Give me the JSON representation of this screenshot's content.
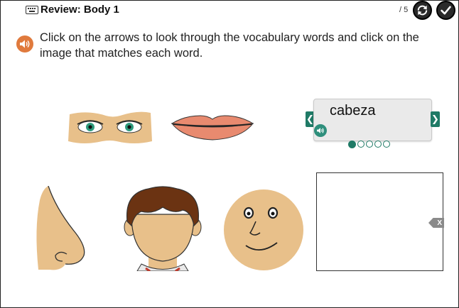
{
  "header": {
    "title": "Review: Body 1",
    "page_count": "/ 5",
    "keyboard_icon": "keyboard-icon",
    "refresh_icon": "refresh-icon",
    "check_icon": "check-icon"
  },
  "instructions": {
    "text": "Click on the arrows to look through the vocabulary words and click on the image that matches each word.",
    "audio_icon": "speaker-icon"
  },
  "vocab": {
    "word": "cabeza",
    "prev_arrow": "❮",
    "next_arrow": "❯",
    "total": 5,
    "current": 1
  },
  "answer_box": {
    "clear_label": "X"
  },
  "images": [
    "eyes",
    "lips",
    "nose",
    "head",
    "face"
  ],
  "colors": {
    "accent_green": "#1f7a66",
    "speaker_orange": "#e07a3d",
    "skin": "#e8c08a",
    "lips": "#e88a6f"
  }
}
